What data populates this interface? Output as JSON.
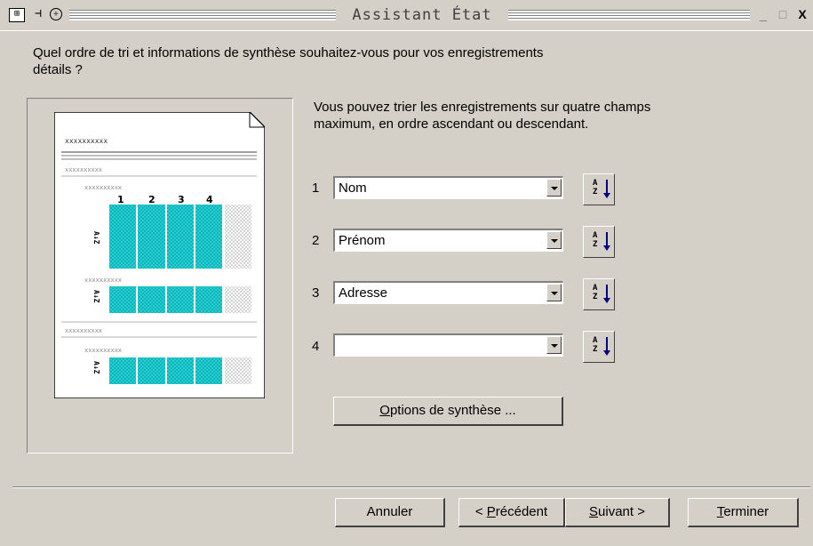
{
  "window": {
    "title": "Assistant État",
    "controls": {
      "minimize": "_",
      "maximize": "□",
      "close": "X"
    }
  },
  "titlebar_icons": [
    "form-icon",
    "pin-icon",
    "dropdown-circle-icon"
  ],
  "question": "Quel ordre de tri et informations de synthèse souhaitez-vous pour vos enregistrements détails ?",
  "hint": "Vous pouvez trier les enregistrements sur quatre champs maximum, en ordre ascendant ou descendant.",
  "preview": {
    "placeholder": "xxxxxxxxxx",
    "column_numbers": [
      "1",
      "2",
      "3",
      "4"
    ],
    "cell_text": "xxxxx",
    "sort_glyph": "A↓Z",
    "highlight_color": "#00e0e8"
  },
  "sort_fields": [
    {
      "number": "1",
      "value": "Nom",
      "sort_icon": "sort-ascending-icon"
    },
    {
      "number": "2",
      "value": "Prénom",
      "sort_icon": "sort-ascending-icon"
    },
    {
      "number": "3",
      "value": "Adresse",
      "sort_icon": "sort-ascending-icon"
    },
    {
      "number": "4",
      "value": "",
      "sort_icon": "sort-ascending-icon"
    }
  ],
  "sort_button_text": {
    "top": "A",
    "bottom": "Z"
  },
  "summary_button": {
    "access_key": "O",
    "rest": "ptions de synthèse ..."
  },
  "footer": {
    "cancel": "Annuler",
    "back": {
      "prefix": "< ",
      "access_key": "P",
      "rest": "récédent"
    },
    "next": {
      "access_key": "S",
      "rest": "uivant",
      "suffix": " >"
    },
    "finish": {
      "access_key": "T",
      "rest": "erminer"
    }
  }
}
